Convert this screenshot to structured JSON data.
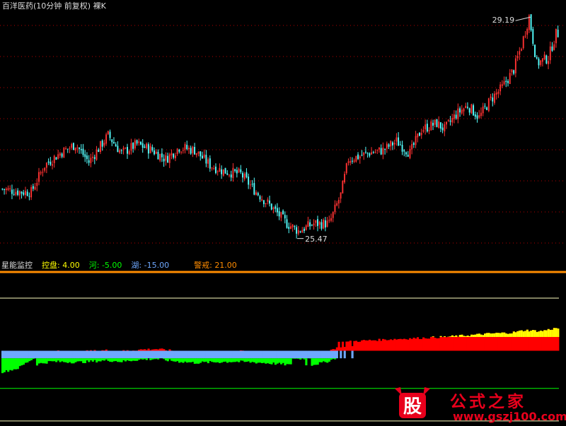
{
  "header": {
    "title": "百洋医药(10分钟 前复权) 裸K"
  },
  "indicator": {
    "name": "星能监控",
    "items": [
      {
        "label": "控盘:",
        "value": "4.00",
        "color": "#ffff00"
      },
      {
        "label": "河:",
        "value": "-5.00",
        "color": "#00ff00"
      },
      {
        "label": "湖:",
        "value": "-15.00",
        "color": "#6ea8fe"
      },
      {
        "label": "警戒:",
        "value": "21.00",
        "color": "#ff8c00"
      }
    ]
  },
  "watermark": {
    "logo_char": "股",
    "text": "公式之家",
    "url": "www.gszj100.com"
  },
  "colors": {
    "up": "#ff3232",
    "down": "#54ffff",
    "warning": "#ff8c00",
    "control": "#ffff00",
    "river": "#00ff00",
    "lake": "#6ea8fe",
    "red_area": "#ff0000",
    "grid": "#b40000"
  },
  "chart_data": [
    {
      "type": "candlestick",
      "title": "百洋医药(10分钟 前复权) 裸K",
      "ylim": [
        25.3,
        29.3
      ],
      "high_label": "29.19",
      "low_label": "25.47",
      "key_points": [
        [
          0,
          26.3
        ],
        [
          10,
          26.25
        ],
        [
          15,
          26.25
        ],
        [
          22,
          26.7
        ],
        [
          30,
          26.9
        ],
        [
          38,
          27.05
        ],
        [
          45,
          26.75
        ],
        [
          55,
          27.2
        ],
        [
          62,
          26.9
        ],
        [
          70,
          27.05
        ],
        [
          78,
          26.95
        ],
        [
          85,
          26.8
        ],
        [
          92,
          27.0
        ],
        [
          100,
          26.95
        ],
        [
          108,
          26.7
        ],
        [
          115,
          26.6
        ],
        [
          124,
          26.55
        ],
        [
          132,
          26.25
        ],
        [
          140,
          26.0
        ],
        [
          148,
          25.72
        ],
        [
          154,
          25.6
        ],
        [
          162,
          25.72
        ],
        [
          170,
          25.72
        ],
        [
          176,
          26.2
        ],
        [
          180,
          26.8
        ],
        [
          186,
          26.85
        ],
        [
          190,
          26.9
        ],
        [
          198,
          26.95
        ],
        [
          205,
          27.1
        ],
        [
          212,
          26.9
        ],
        [
          218,
          27.3
        ],
        [
          226,
          27.4
        ],
        [
          230,
          27.3
        ],
        [
          236,
          27.55
        ],
        [
          242,
          27.7
        ],
        [
          248,
          27.5
        ],
        [
          254,
          27.8
        ],
        [
          260,
          28.0
        ],
        [
          266,
          28.3
        ],
        [
          270,
          28.7
        ],
        [
          274,
          29.19
        ],
        [
          278,
          28.4
        ],
        [
          284,
          28.5
        ],
        [
          288,
          28.9
        ]
      ],
      "bars": 290
    },
    {
      "type": "area",
      "title": "星能监控",
      "ylim": [
        -30,
        30
      ],
      "levels": {
        "control": 4,
        "river": -5,
        "lake": -15,
        "warning": 21
      },
      "key_points": [
        [
          0,
          -5.5
        ],
        [
          8,
          -4
        ],
        [
          14,
          -1
        ],
        [
          18,
          0.5
        ],
        [
          25,
          1.4
        ],
        [
          40,
          1.2
        ],
        [
          55,
          1.8
        ],
        [
          62,
          1.4
        ],
        [
          70,
          2.0
        ],
        [
          80,
          2.3
        ],
        [
          90,
          1.5
        ],
        [
          100,
          1.0
        ],
        [
          110,
          1.2
        ],
        [
          120,
          1.4
        ],
        [
          130,
          1.2
        ],
        [
          140,
          0.8
        ],
        [
          148,
          0.4
        ],
        [
          154,
          -0.3
        ],
        [
          160,
          0.2
        ],
        [
          168,
          1.2
        ],
        [
          172,
          2.2
        ],
        [
          175,
          3.3
        ],
        [
          185,
          3.9
        ],
        [
          200,
          4.5
        ],
        [
          215,
          5.0
        ],
        [
          230,
          5.5
        ],
        [
          245,
          6.3
        ],
        [
          255,
          6.9
        ],
        [
          265,
          7.2
        ],
        [
          272,
          8.2
        ],
        [
          280,
          7.8
        ],
        [
          288,
          9.0
        ]
      ]
    }
  ]
}
